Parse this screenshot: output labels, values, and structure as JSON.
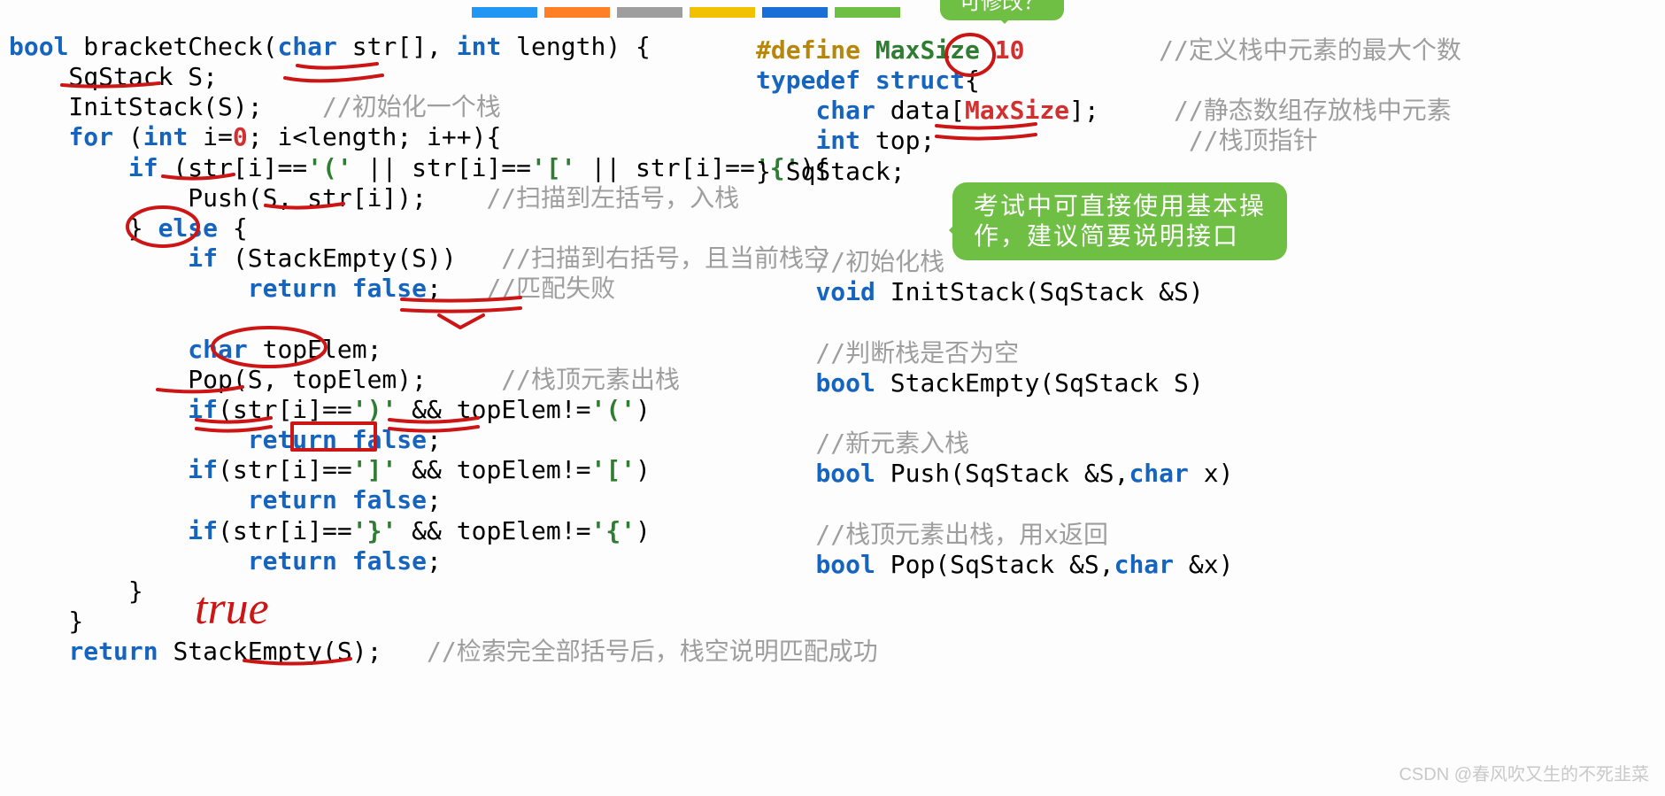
{
  "swatches": [
    "#2196f3",
    "#ff7f27",
    "#9e9e9e",
    "#f2c200",
    "#1a6fd6",
    "#6fbf44"
  ],
  "bubble_top": "可修改？",
  "bubble_main_l1": "考试中可直接使用基本操",
  "bubble_main_l2": "作，建议简要说明接口",
  "annotation_handwritten": "true",
  "watermark": "CSDN @春风吹又生的不死韭菜",
  "left_code": {
    "l1": {
      "a": "bool",
      "b": " bracketCheck(",
      "c": "char",
      "d": " str[], ",
      "e": "int",
      "f": " length) {"
    },
    "l2": {
      "a": "    SqStack S;"
    },
    "l3": {
      "a": "    InitStack(S);",
      "cm": "    //初始化一个栈"
    },
    "l4": {
      "a": "    ",
      "b": "for",
      "c": " (",
      "d": "int",
      "e": " i=",
      "f": "0",
      "g": "; i<length; i++){"
    },
    "l5": {
      "a": "        ",
      "b": "if",
      "c": " (str[i]==",
      "d": "'('",
      "e": " || str[i]==",
      "f": "'['",
      "g": " || str[i]==",
      "h": "'{'",
      "i": "){"
    },
    "l6": {
      "a": "            Push(S, str[i]);",
      "cm": "    //扫描到左括号，入栈"
    },
    "l7": {
      "a": "        } ",
      "b": "else",
      "c": " {"
    },
    "l8": {
      "a": "            ",
      "b": "if",
      "c": " (StackEmpty(S))",
      "cm": "   //扫描到右括号，且当前栈空"
    },
    "l9": {
      "a": "                ",
      "b": "return false",
      "c": ";",
      "cm": "   //匹配失败"
    },
    "blank": "",
    "l10": {
      "a": "            ",
      "b": "char",
      "c": " topElem;"
    },
    "l11": {
      "a": "            Pop(S, topElem);",
      "cm": "     //栈顶元素出栈"
    },
    "l12": {
      "a": "            ",
      "b": "if",
      "c": "(str[i]==",
      "d": "')'",
      "e": " && topElem!=",
      "f": "'('",
      "g": ")"
    },
    "l13": {
      "a": "                ",
      "b": "return false",
      "c": ";"
    },
    "l14": {
      "a": "            ",
      "b": "if",
      "c": "(str[i]==",
      "d": "']'",
      "e": " && topElem!=",
      "f": "'['",
      "g": ")"
    },
    "l15": {
      "a": "                ",
      "b": "return false",
      "c": ";"
    },
    "l16": {
      "a": "            ",
      "b": "if",
      "c": "(str[i]==",
      "d": "'}'",
      "e": " && topElem!=",
      "f": "'{'",
      "g": ")"
    },
    "l17": {
      "a": "                ",
      "b": "return false",
      "c": ";"
    },
    "l18": {
      "a": "        }"
    },
    "l19": {
      "a": "    }"
    },
    "l20": {
      "a": "    ",
      "b": "return",
      "c": " StackEmpty(S);",
      "cm": "   //检索完全部括号后，栈空说明匹配成功"
    }
  },
  "right_code": {
    "r1": {
      "a": "#define",
      "b": " MaxSize ",
      "c": "10",
      "cm": "         //定义栈中元素的最大个数"
    },
    "r2": {
      "a": "typedef struct",
      "b": "{"
    },
    "r3": {
      "a": "    ",
      "b": "char",
      "c": " data[",
      "d": "MaxSize",
      "e": "];",
      "cm": "     //静态数组存放栈中元素"
    },
    "r4": {
      "a": "    ",
      "b": "int",
      "c": " top;",
      "cm": "                 //栈顶指针"
    },
    "r5": {
      "a": "} SqStack;"
    },
    "blank": "",
    "c1": "    //初始化栈",
    "f1": {
      "a": "    ",
      "b": "void",
      "c": " InitStack(SqStack &S)"
    },
    "c2": "    //判断栈是否为空",
    "f2": {
      "a": "    ",
      "b": "bool",
      "c": " StackEmpty(SqStack S)"
    },
    "c3": "    //新元素入栈",
    "f3": {
      "a": "    ",
      "b": "bool",
      "c": " Push(SqStack &S,",
      "d": "char",
      "e": " x)"
    },
    "c4": "    //栈顶元素出栈，用x返回",
    "f4": {
      "a": "    ",
      "b": "bool",
      "c": " Pop(SqStack &S,",
      "d": "char",
      "e": " &x)"
    }
  }
}
